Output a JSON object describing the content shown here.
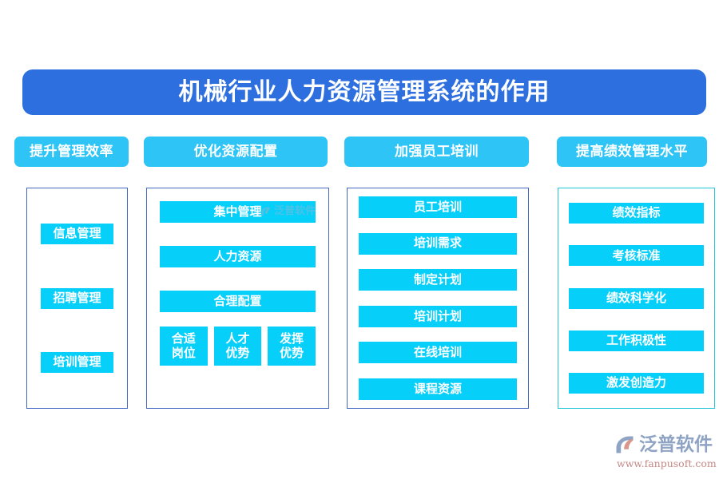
{
  "banner": {
    "title": "机械行业人力资源管理系统的作用",
    "color": "#2e6fe0"
  },
  "theme": {
    "header_color": "#2ec4f5",
    "tag_color": "#06cffa",
    "panel_border": "#4368c4",
    "panel_border_alt": "#21c7d6",
    "background": "#ffffff",
    "text_on_color": "#ffffff"
  },
  "columns": [
    {
      "header": "提升管理效率",
      "items": [
        {
          "label": "信息管理"
        },
        {
          "label": "招聘管理"
        },
        {
          "label": "培训管理"
        }
      ]
    },
    {
      "header": "优化资源配置",
      "items": [
        {
          "label": "集中管理"
        },
        {
          "label": "人力资源"
        },
        {
          "label": "合理配置"
        }
      ],
      "sub_items": [
        {
          "line1": "合适",
          "line2": "岗位"
        },
        {
          "line1": "人才",
          "line2": "优势"
        },
        {
          "line1": "发挥",
          "line2": "优势"
        }
      ]
    },
    {
      "header": "加强员工培训",
      "items": [
        {
          "label": "员工培训"
        },
        {
          "label": "培训需求"
        },
        {
          "label": "制定计划"
        },
        {
          "label": "培训计划"
        },
        {
          "label": "在线培训"
        },
        {
          "label": "课程资源"
        }
      ]
    },
    {
      "header": "提高绩效管理水平",
      "items": [
        {
          "label": "绩效指标"
        },
        {
          "label": "考核标准"
        },
        {
          "label": "绩效科学化"
        },
        {
          "label": "工作积极性"
        },
        {
          "label": "激发创造力"
        }
      ]
    }
  ],
  "watermark": {
    "text": "泛普软件"
  },
  "brand": {
    "name": "泛普软件",
    "url": "www.fanpusoft.com",
    "name_color": "#8fa4c4",
    "url_color": "#c08a86"
  }
}
